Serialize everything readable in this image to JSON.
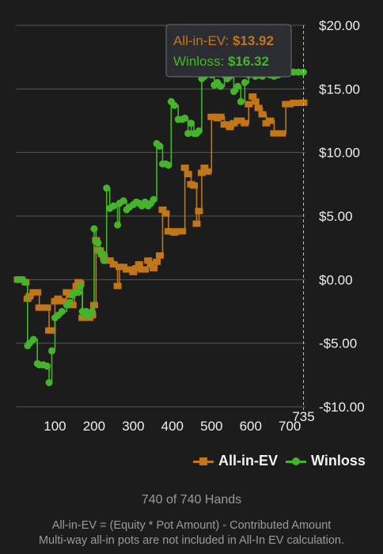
{
  "chart_data": {
    "type": "line",
    "x_ticks": [
      100,
      200,
      300,
      400,
      500,
      600,
      700
    ],
    "y_ticks": [
      "$20.00",
      "$15.00",
      "$10.00",
      "$5.00",
      "$0.00",
      "-$5.00",
      "-$10.00"
    ],
    "y_tick_values": [
      20,
      15,
      10,
      5,
      0,
      -5,
      -10
    ],
    "xlim": [
      0,
      740
    ],
    "ylim": [
      -10,
      20
    ],
    "grid": true,
    "crosshair_label": "735",
    "legend_position": "bottom-right",
    "tooltip": [
      {
        "label": "All-in-EV: ",
        "value": "$13.92",
        "color": "#c27519"
      },
      {
        "label": "Winloss: ",
        "value": "$16.32",
        "color": "#44b52a"
      }
    ],
    "series": [
      {
        "name": "All-in-EV",
        "color": "#c27519",
        "marker": "square",
        "x": [
          5,
          15,
          25,
          30,
          35,
          45,
          55,
          60,
          70,
          80,
          85,
          92,
          100,
          108,
          118,
          130,
          138,
          145,
          150,
          155,
          160,
          165,
          170,
          175,
          180,
          188,
          195,
          200,
          205,
          210,
          215,
          220,
          225,
          232,
          240,
          250,
          260,
          265,
          275,
          283,
          290,
          300,
          308,
          315,
          322,
          330,
          338,
          345,
          352,
          360,
          368,
          375,
          383,
          390,
          397,
          405,
          415,
          425,
          432,
          440,
          448,
          455,
          462,
          468,
          475,
          482,
          490,
          500,
          507,
          515,
          523,
          533,
          540,
          547,
          557,
          567,
          575,
          585,
          595,
          605,
          612,
          620,
          630,
          640,
          650,
          660,
          670,
          680,
          690,
          700,
          710,
          722,
          735
        ],
        "y": [
          0.0,
          0.0,
          -0.2,
          -1.5,
          -1.3,
          -1.0,
          -1.0,
          -2.2,
          -2.2,
          -2.2,
          -4.0,
          -4.0,
          -1.7,
          -1.5,
          -1.7,
          -1.0,
          -1.2,
          -2.0,
          -1.0,
          -0.5,
          -0.2,
          -0.3,
          -3.0,
          -3.0,
          -2.8,
          -3.0,
          -2.8,
          -2.0,
          3.1,
          2.3,
          2.3,
          2.0,
          1.8,
          1.5,
          1.5,
          1.2,
          -0.5,
          1.0,
          1.0,
          0.8,
          0.8,
          0.6,
          0.9,
          1.2,
          0.8,
          0.8,
          1.5,
          1.2,
          0.9,
          1.4,
          1.9,
          5.5,
          5.2,
          3.8,
          3.8,
          3.7,
          3.8,
          3.8,
          8.8,
          8.3,
          7.5,
          7.4,
          4.4,
          5.4,
          8.4,
          8.8,
          8.5,
          12.8,
          12.8,
          12.7,
          12.8,
          12.2,
          12.2,
          12.0,
          12.3,
          12.5,
          12.5,
          12.3,
          13.8,
          14.4,
          14.0,
          13.5,
          13.0,
          12.3,
          12.5,
          11.5,
          11.5,
          11.5,
          13.8,
          13.8,
          13.9,
          13.9,
          13.92
        ]
      },
      {
        "name": "Winloss",
        "color": "#44b52a",
        "marker": "circle",
        "x": [
          5,
          15,
          25,
          30,
          35,
          45,
          55,
          60,
          70,
          80,
          85,
          92,
          100,
          108,
          118,
          130,
          138,
          145,
          150,
          155,
          160,
          165,
          170,
          175,
          180,
          188,
          195,
          200,
          205,
          210,
          215,
          220,
          225,
          232,
          240,
          250,
          260,
          265,
          275,
          283,
          290,
          300,
          308,
          315,
          322,
          330,
          338,
          345,
          352,
          360,
          368,
          375,
          383,
          390,
          397,
          405,
          415,
          425,
          432,
          440,
          448,
          455,
          462,
          468,
          475,
          482,
          490,
          500,
          507,
          515,
          523,
          533,
          540,
          547,
          557,
          567,
          575,
          585,
          595,
          605,
          612,
          620,
          630,
          640,
          650,
          660,
          670,
          680,
          690,
          700,
          710,
          722,
          735
        ],
        "y": [
          0.0,
          0.0,
          -0.2,
          -5.2,
          -5.0,
          -4.7,
          -6.6,
          -6.7,
          -6.7,
          -6.8,
          -8.1,
          -5.6,
          -3.0,
          -2.8,
          -2.5,
          -2.0,
          -1.8,
          -1.2,
          -1.0,
          -1.0,
          -1.0,
          -0.5,
          -2.5,
          -2.8,
          -2.5,
          -2.8,
          -2.5,
          4.0,
          3.0,
          2.9,
          2.2,
          2.0,
          1.5,
          7.2,
          5.6,
          5.8,
          4.3,
          6.0,
          6.2,
          5.5,
          5.7,
          5.9,
          6.1,
          6.0,
          5.8,
          6.1,
          5.8,
          6.0,
          6.3,
          10.7,
          10.5,
          9.1,
          9.1,
          9.0,
          14.0,
          13.7,
          12.6,
          12.6,
          12.7,
          11.5,
          12.3,
          11.5,
          11.5,
          11.7,
          15.8,
          16.0,
          16.2,
          16.1,
          15.3,
          15.5,
          15.2,
          16.1,
          15.8,
          16.0,
          14.8,
          15.2,
          14.0,
          15.5,
          16.1,
          16.2,
          16.0,
          16.1,
          16.0,
          16.2,
          16.1,
          16.0,
          16.1,
          16.2,
          16.32,
          16.32,
          16.32,
          16.32,
          16.32
        ]
      }
    ]
  },
  "footer": {
    "hands": "740 of 740 Hands",
    "note1": "All-in-EV = (Equity * Pot Amount) - Contributed Amount",
    "note2": "Multi-way all-in pots are not included in All-In EV calculation."
  }
}
